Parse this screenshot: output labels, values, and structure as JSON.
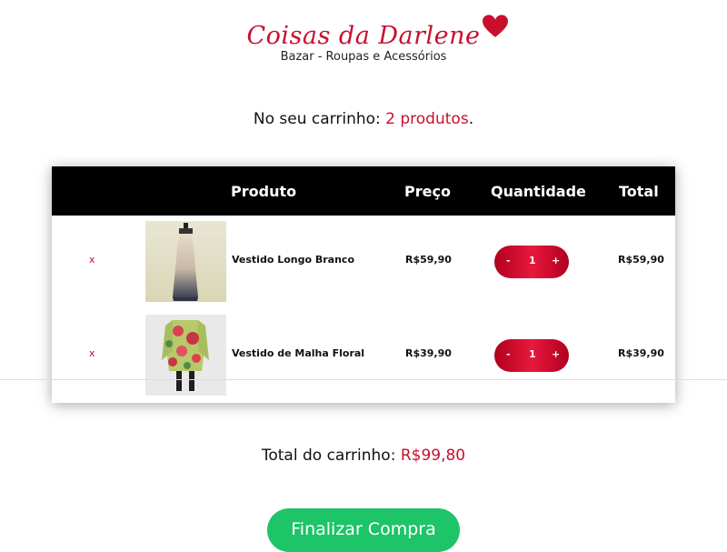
{
  "brand": {
    "name": "Coisas da Darlene",
    "tagline": "Bazar - Roupas e Acessórios"
  },
  "cart": {
    "prefix": "No seu carrinho: ",
    "count": "2 produtos",
    "suffix": "."
  },
  "table": {
    "headers": {
      "product": "Produto",
      "price": "Preço",
      "quantity": "Quantidade",
      "total": "Total"
    },
    "rows": [
      {
        "remove": "x",
        "name": "Vestido Longo Branco",
        "price": "R$59,90",
        "qty": "1",
        "total": "R$59,90"
      },
      {
        "remove": "x",
        "name": "Vestido de Malha Floral",
        "price": "R$39,90",
        "qty": "1",
        "total": "R$39,90"
      }
    ],
    "minus": "-",
    "plus": "+"
  },
  "summary": {
    "label": "Total do carrinho: ",
    "value": "R$99,80"
  },
  "checkout": {
    "label": "Finalizar Compra"
  },
  "colors": {
    "accent": "#c8102e",
    "checkout": "#1ec468",
    "header": "#000000"
  }
}
